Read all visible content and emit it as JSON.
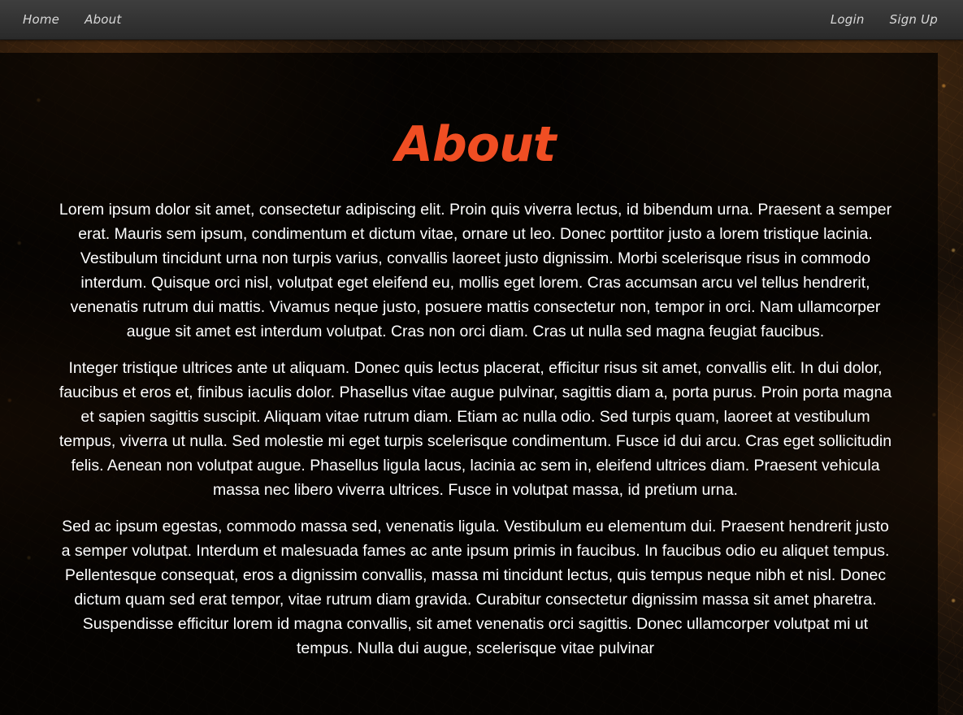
{
  "nav": {
    "left": [
      "Home",
      "About"
    ],
    "right": [
      "Login",
      "Sign Up"
    ]
  },
  "page": {
    "title": "About",
    "paragraphs": [
      "Lorem ipsum dolor sit amet, consectetur adipiscing elit. Proin quis viverra lectus, id bibendum urna. Praesent a semper erat. Mauris sem ipsum, condimentum et dictum vitae, ornare ut leo. Donec porttitor justo a lorem tristique lacinia. Vestibulum tincidunt urna non turpis varius, convallis laoreet justo dignissim. Morbi scelerisque risus in commodo interdum. Quisque orci nisl, volutpat eget eleifend eu, mollis eget lorem. Cras accumsan arcu vel tellus hendrerit, venenatis rutrum dui mattis. Vivamus neque justo, posuere mattis consectetur non, tempor in orci. Nam ullamcorper augue sit amet est interdum volutpat. Cras non orci diam. Cras ut nulla sed magna feugiat faucibus.",
      "Integer tristique ultrices ante ut aliquam. Donec quis lectus placerat, efficitur risus sit amet, convallis elit. In dui dolor, faucibus et eros et, finibus iaculis dolor. Phasellus vitae augue pulvinar, sagittis diam a, porta purus. Proin porta magna et sapien sagittis suscipit. Aliquam vitae rutrum diam. Etiam ac nulla odio. Sed turpis quam, laoreet at vestibulum tempus, viverra ut nulla. Sed molestie mi eget turpis scelerisque condimentum. Fusce id dui arcu. Cras eget sollicitudin felis. Aenean non volutpat augue. Phasellus ligula lacus, lacinia ac sem in, eleifend ultrices diam. Praesent vehicula massa nec libero viverra ultrices. Fusce in volutpat massa, id pretium urna.",
      "Sed ac ipsum egestas, commodo massa sed, venenatis ligula. Vestibulum eu elementum dui. Praesent hendrerit justo a semper volutpat. Interdum et malesuada fames ac ante ipsum primis in faucibus. In faucibus odio eu aliquet tempus. Pellentesque consequat, eros a dignissim convallis, massa mi tincidunt lectus, quis tempus neque nibh et nisl. Donec dictum quam sed erat tempor, vitae rutrum diam gravida. Curabitur consectetur dignissim massa sit amet pharetra. Suspendisse efficitur lorem id magna convallis, sit amet venenatis orci sagittis. Donec ullamcorper volutpat mi ut tempus. Nulla dui augue, scelerisque vitae pulvinar"
    ]
  },
  "colors": {
    "accent": "#f04e23",
    "navbar": "#333333",
    "text": "#ffffff"
  }
}
